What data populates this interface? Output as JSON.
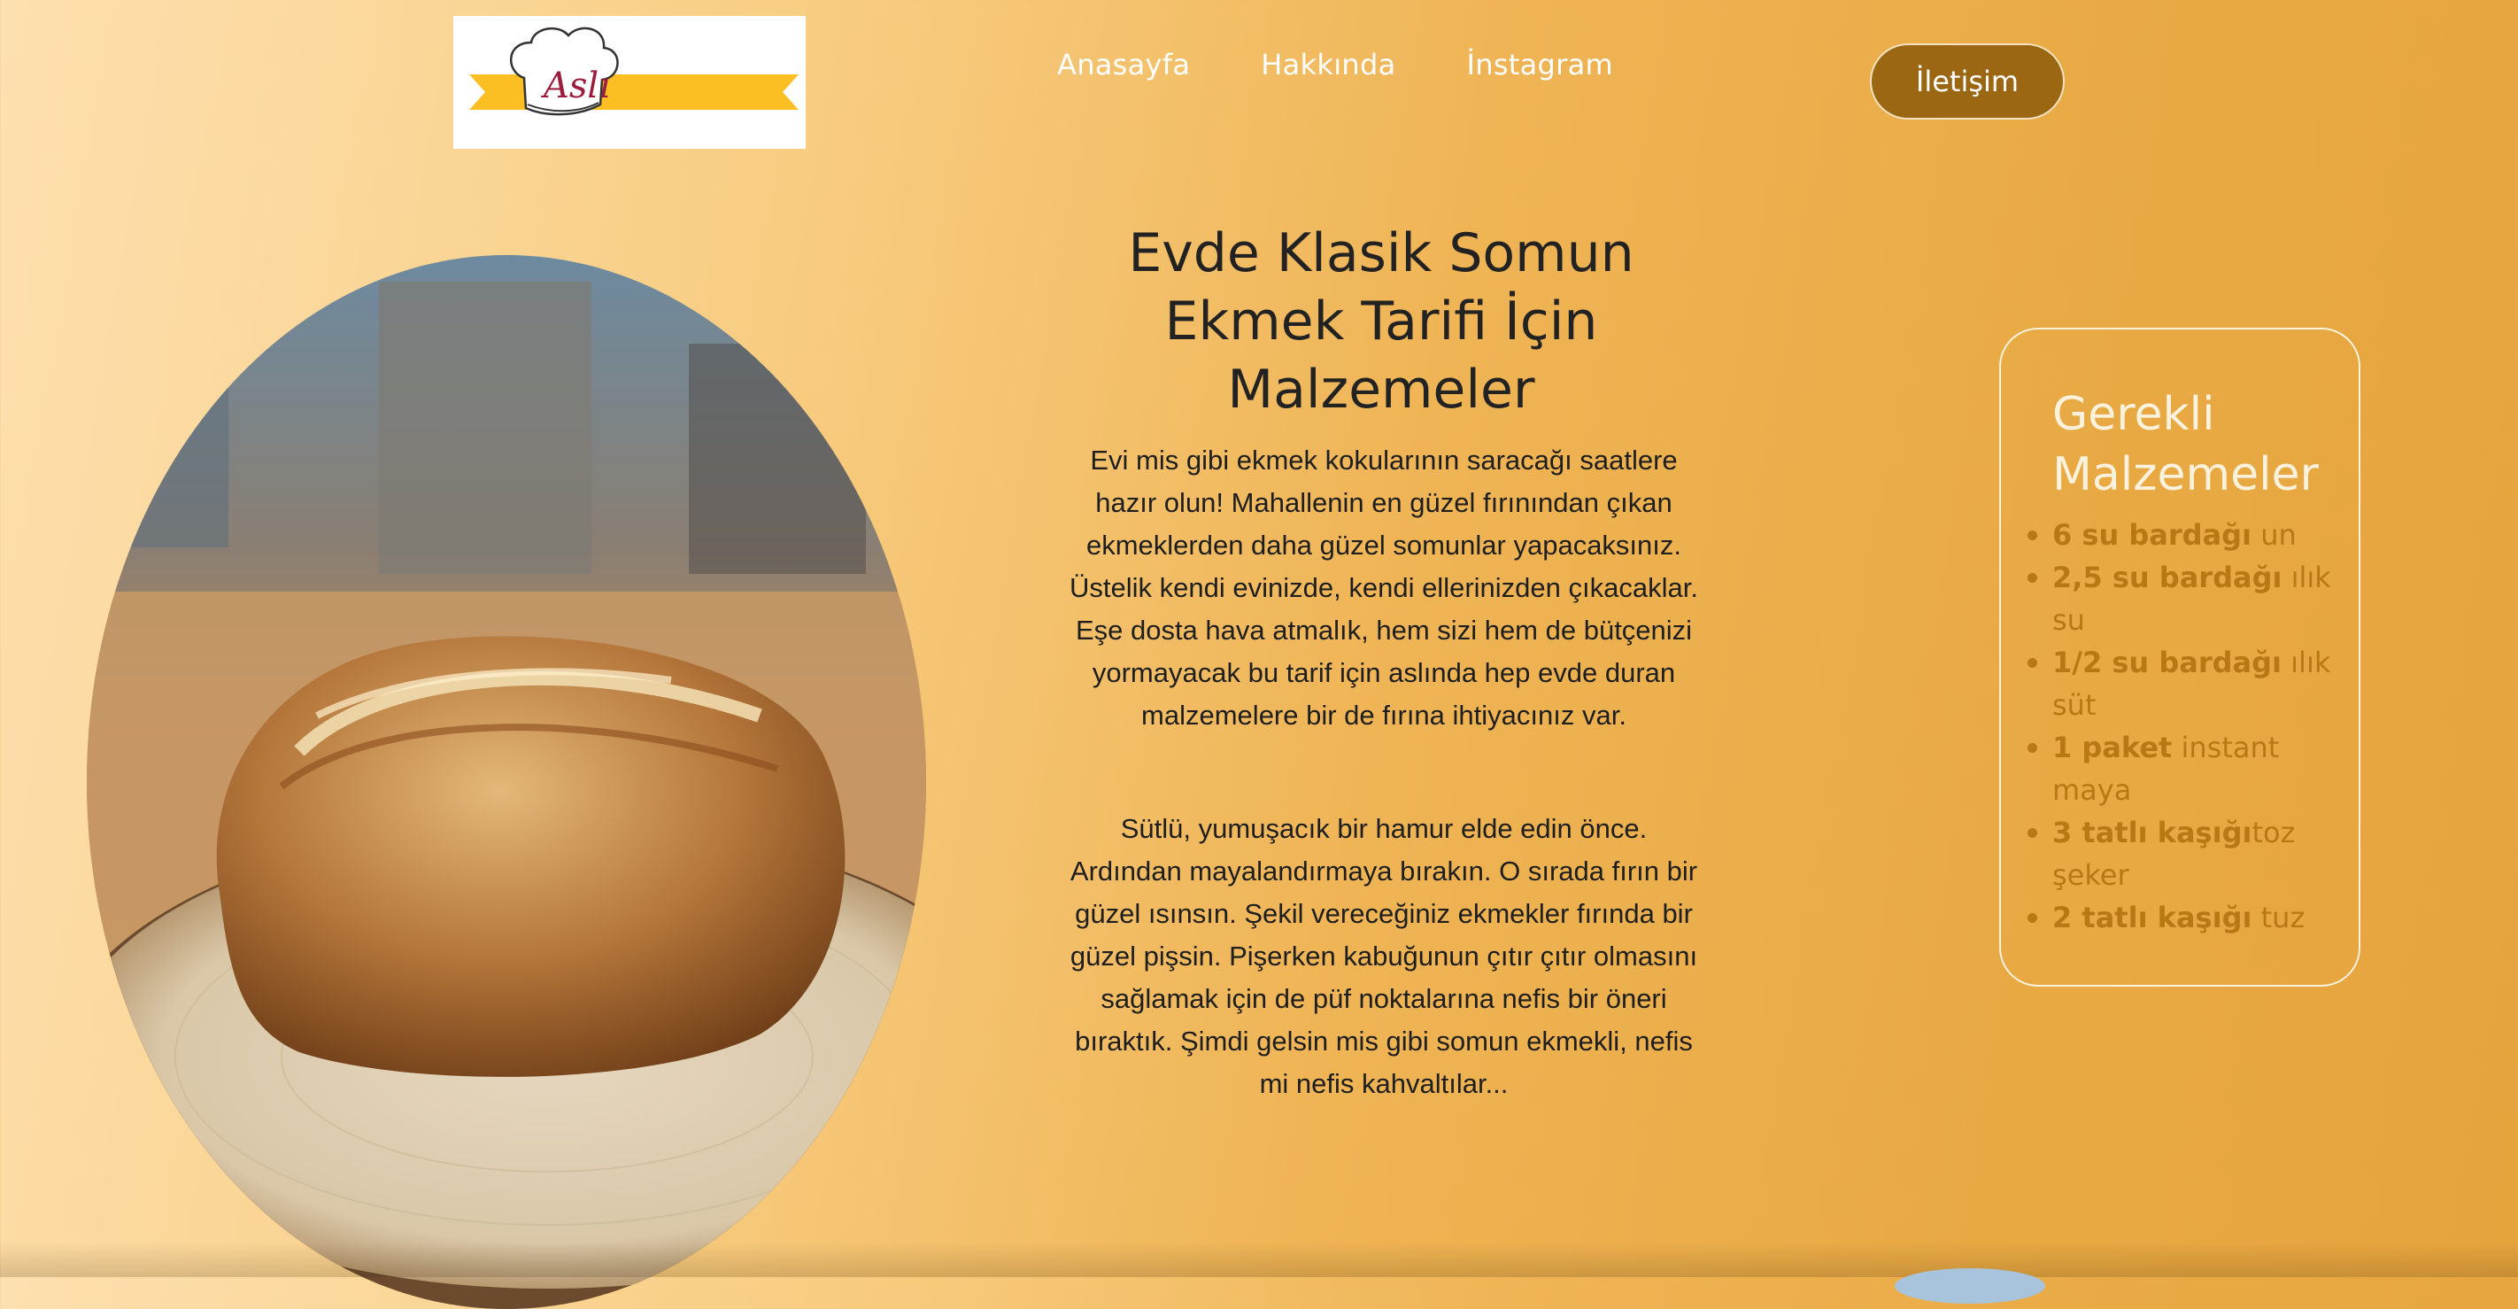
{
  "header": {
    "logo_text": "Aslı",
    "nav": [
      {
        "label": "Anasayfa"
      },
      {
        "label": "Hakkında"
      },
      {
        "label": "İnstagram"
      }
    ],
    "contact_label": "İletişim"
  },
  "main": {
    "title": "Evde Klasik Somun Ekmek Tarifi İçin Malzemeler",
    "paragraph1": "Evi mis gibi ekmek kokularının saracağı saatlere hazır olun! Mahallenin en güzel fırınından çıkan ekmeklerden daha güzel somunlar yapacaksınız. Üstelik kendi evinizde, kendi ellerinizden çıkacaklar. Eşe dosta hava atmalık, hem sizi hem de bütçenizi yormayacak bu tarif için aslında hep evde duran malzemelere bir de fırına ihtiyacınız var.",
    "paragraph2": "Sütlü, yumuşacık bir hamur elde edin önce. Ardından mayalandırmaya bırakın. O sırada fırın bir güzel ısınsın. Şekil vereceğiniz ekmekler fırında bir güzel pişsin. Pişerken kabuğunun çıtır çıtır olmasını sağlamak için de püf noktalarına nefis bir öneri bıraktık. Şimdi gelsin mis gibi somun ekmekli, nefis mi nefis kahvaltılar..."
  },
  "ingredients": {
    "title": "Gerekli Malzemeler",
    "items": [
      {
        "qty": "6 su bardağı",
        "name": " un"
      },
      {
        "qty": "2,5 su bardağı",
        "name": " ılık su"
      },
      {
        "qty": "1/2 su bardağı",
        "name": " ılık süt"
      },
      {
        "qty": "1 paket",
        "name": " instant maya"
      },
      {
        "qty": "3 tatlı kaşığı",
        "name": "toz şeker"
      },
      {
        "qty": "2 tatlı kaşığı",
        "name": " tuz"
      }
    ]
  },
  "colors": {
    "accent": "#9c6713",
    "ingredient_text": "#b87814",
    "logo_ribbon": "#fbbf24",
    "logo_brand": "#9b1c3c"
  },
  "icons": {
    "logo": "chef-hat-logo"
  }
}
